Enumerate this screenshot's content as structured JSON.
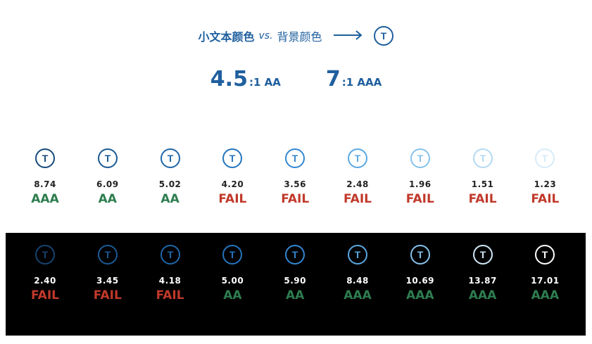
{
  "header": {
    "small_text": "小文本颜色",
    "vs": "vs.",
    "background": "背景颜色",
    "icon": "T"
  },
  "ratios": [
    {
      "value": "4.5",
      "suffix": ":1 AA"
    },
    {
      "value": "7",
      "suffix": ":1 AAA"
    }
  ],
  "colors": {
    "heading": "#1f5f9e",
    "pass": "#2e7d4f",
    "fail": "#c0392b",
    "dark_bg": "#000000"
  },
  "light_row": [
    {
      "ratio": "8.74",
      "grade": "AAA",
      "pass": true,
      "color": "#174a7c"
    },
    {
      "ratio": "6.09",
      "grade": "AA",
      "pass": true,
      "color": "#1a5a94"
    },
    {
      "ratio": "5.02",
      "grade": "AA",
      "pass": true,
      "color": "#1f67a9"
    },
    {
      "ratio": "4.20",
      "grade": "FAIL",
      "pass": false,
      "color": "#2375be"
    },
    {
      "ratio": "3.56",
      "grade": "FAIL",
      "pass": false,
      "color": "#3387d2"
    },
    {
      "ratio": "2.48",
      "grade": "FAIL",
      "pass": false,
      "color": "#5aa8e2"
    },
    {
      "ratio": "1.96",
      "grade": "FAIL",
      "pass": false,
      "color": "#86c2ec"
    },
    {
      "ratio": "1.51",
      "grade": "FAIL",
      "pass": false,
      "color": "#b3daf4"
    },
    {
      "ratio": "1.23",
      "grade": "FAIL",
      "pass": false,
      "color": "#d6ecf9"
    }
  ],
  "dark_row": [
    {
      "ratio": "2.40",
      "grade": "FAIL",
      "pass": false,
      "color": "#164470"
    },
    {
      "ratio": "3.45",
      "grade": "FAIL",
      "pass": false,
      "color": "#1a5a94"
    },
    {
      "ratio": "4.18",
      "grade": "FAIL",
      "pass": false,
      "color": "#1f67a9"
    },
    {
      "ratio": "5.00",
      "grade": "AA",
      "pass": true,
      "color": "#2375be"
    },
    {
      "ratio": "5.90",
      "grade": "AA",
      "pass": true,
      "color": "#3387d2"
    },
    {
      "ratio": "8.48",
      "grade": "AAA",
      "pass": true,
      "color": "#5aa8e2"
    },
    {
      "ratio": "10.69",
      "grade": "AAA",
      "pass": true,
      "color": "#86c2ec"
    },
    {
      "ratio": "13.87",
      "grade": "AAA",
      "pass": true,
      "color": "#d0e8f7"
    },
    {
      "ratio": "17.01",
      "grade": "AAA",
      "pass": true,
      "color": "#ffffff"
    }
  ]
}
